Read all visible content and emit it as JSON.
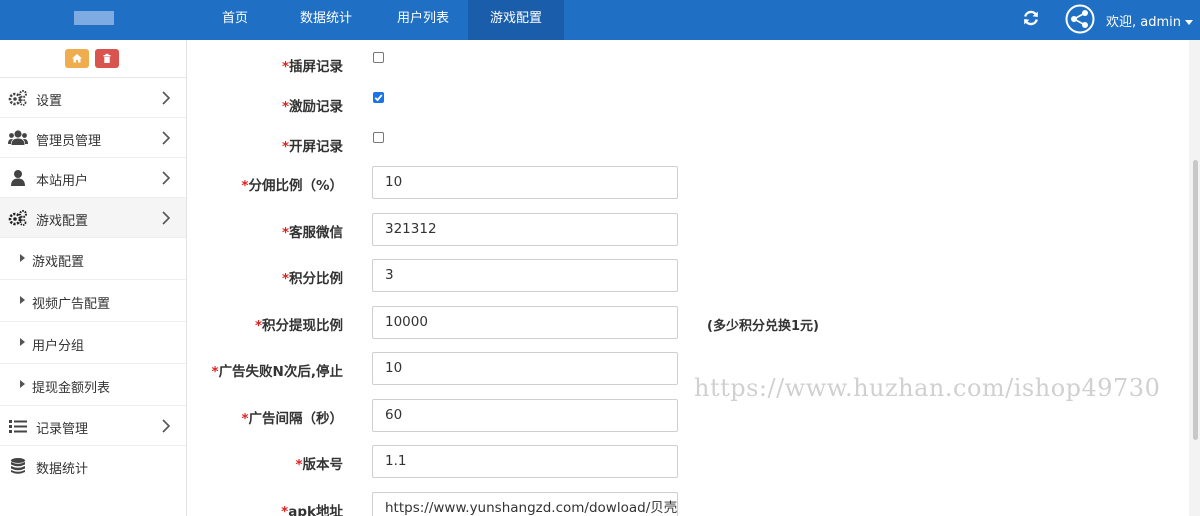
{
  "topbar": {
    "nav": [
      {
        "label": "首页"
      },
      {
        "label": "数据统计"
      },
      {
        "label": "用户列表"
      },
      {
        "label": "游戏配置"
      }
    ],
    "welcome": "欢迎, admin",
    "brand_color": "#1f6fc4",
    "icons": [
      "refresh-icon",
      "share-avatar-icon",
      "caret-down-icon"
    ]
  },
  "sidebar": {
    "tools": [
      "home-icon",
      "trash-icon"
    ],
    "items": [
      {
        "label": "设置",
        "icon": "gears-icon"
      },
      {
        "label": "管理员管理",
        "icon": "users-icon"
      },
      {
        "label": "本站用户",
        "icon": "user-icon"
      },
      {
        "label": "游戏配置",
        "icon": "gears-icon"
      }
    ],
    "subitems": [
      {
        "label": "游戏配置"
      },
      {
        "label": "视频广告配置"
      },
      {
        "label": "用户分组"
      },
      {
        "label": "提现金额列表"
      }
    ],
    "bottom_items": [
      {
        "label": "记录管理",
        "icon": "list-icon"
      },
      {
        "label": "数据统计",
        "icon": "database-icon"
      }
    ]
  },
  "form": {
    "required_mark": "*",
    "fields": [
      {
        "label": "插屏记录",
        "type": "checkbox",
        "checked": false
      },
      {
        "label": "激励记录",
        "type": "checkbox",
        "checked": true
      },
      {
        "label": "开屏记录",
        "type": "checkbox",
        "checked": false
      },
      {
        "label": "分佣比例（%）",
        "type": "text",
        "value": "10"
      },
      {
        "label": "客服微信",
        "type": "text",
        "value": "321312"
      },
      {
        "label": "积分比例",
        "type": "text",
        "value": "3"
      },
      {
        "label": "积分提现比例",
        "type": "text",
        "value": "10000",
        "hint": "(多少积分兑换1元)"
      },
      {
        "label": "广告失败N次后,停止",
        "type": "text",
        "value": "10"
      },
      {
        "label": "广告间隔（秒）",
        "type": "text",
        "value": "60"
      },
      {
        "label": "版本号",
        "type": "text",
        "value": "1.1"
      },
      {
        "label": "apk地址",
        "type": "text",
        "value": "https://www.yunshangzd.com/dowload/贝壳"
      }
    ]
  },
  "watermark": "https://www.huzhan.com/ishop49730"
}
